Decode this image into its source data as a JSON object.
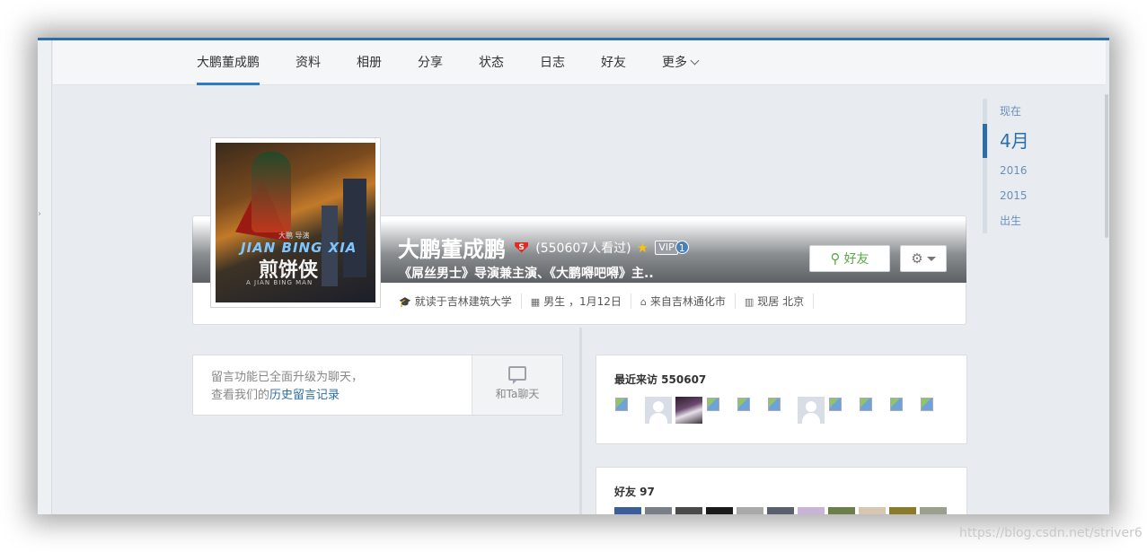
{
  "nav": {
    "items": [
      {
        "label": "大鹏董成鹏",
        "active": true
      },
      {
        "label": "资料"
      },
      {
        "label": "相册"
      },
      {
        "label": "分享"
      },
      {
        "label": "状态"
      },
      {
        "label": "日志"
      },
      {
        "label": "好友"
      },
      {
        "label": "更多"
      }
    ]
  },
  "timeline": [
    "现在",
    "4月",
    "2016",
    "2015",
    "出生"
  ],
  "profile": {
    "name": "大鹏董成鹏",
    "badge_icon": "superman-s-icon",
    "views": "(550607人看过)",
    "vip_label": "VIP",
    "vip_level": "1",
    "intro": "《屌丝男士》导演兼主演、《大鹏嘚吧嘚》主..",
    "friend_button": "好友",
    "poster": {
      "title_en": "JIAN BING XIA",
      "title_cn": "煎饼侠",
      "director_line": "大鹏 导演",
      "subtitle": "A JIAN BING MAN"
    },
    "info": [
      {
        "icon": "graduation-cap-icon",
        "text": "就读于吉林建筑大学"
      },
      {
        "icon": "birthday-cake-icon",
        "text": "男生 ，1月12日"
      },
      {
        "icon": "home-icon",
        "text": "来自吉林通化市"
      },
      {
        "icon": "building-icon",
        "text": "现居 北京"
      }
    ]
  },
  "chat": {
    "line1": "留言功能已全面升级为聊天，",
    "line2_prefix": "查看我们的",
    "line2_link": "历史留言记录",
    "button": "和Ta聊天"
  },
  "visitors": {
    "title": "最近来访 550607",
    "avatars": [
      "broken",
      "default",
      "photo",
      "broken",
      "broken",
      "broken",
      "default",
      "broken",
      "broken",
      "broken",
      "broken"
    ]
  },
  "friends": {
    "title": "好友 97",
    "colors": [
      "#3a5e9c",
      "#7a7e88",
      "#4a4a4a",
      "#1a1a1a",
      "#a9a9a9",
      "#5a6070",
      "#c9b3d8",
      "#6b7f4a",
      "#d8c7b0",
      "#8a7a2a",
      "#9aa08c"
    ]
  },
  "watermark": "https://blog.csdn.net/striver6"
}
